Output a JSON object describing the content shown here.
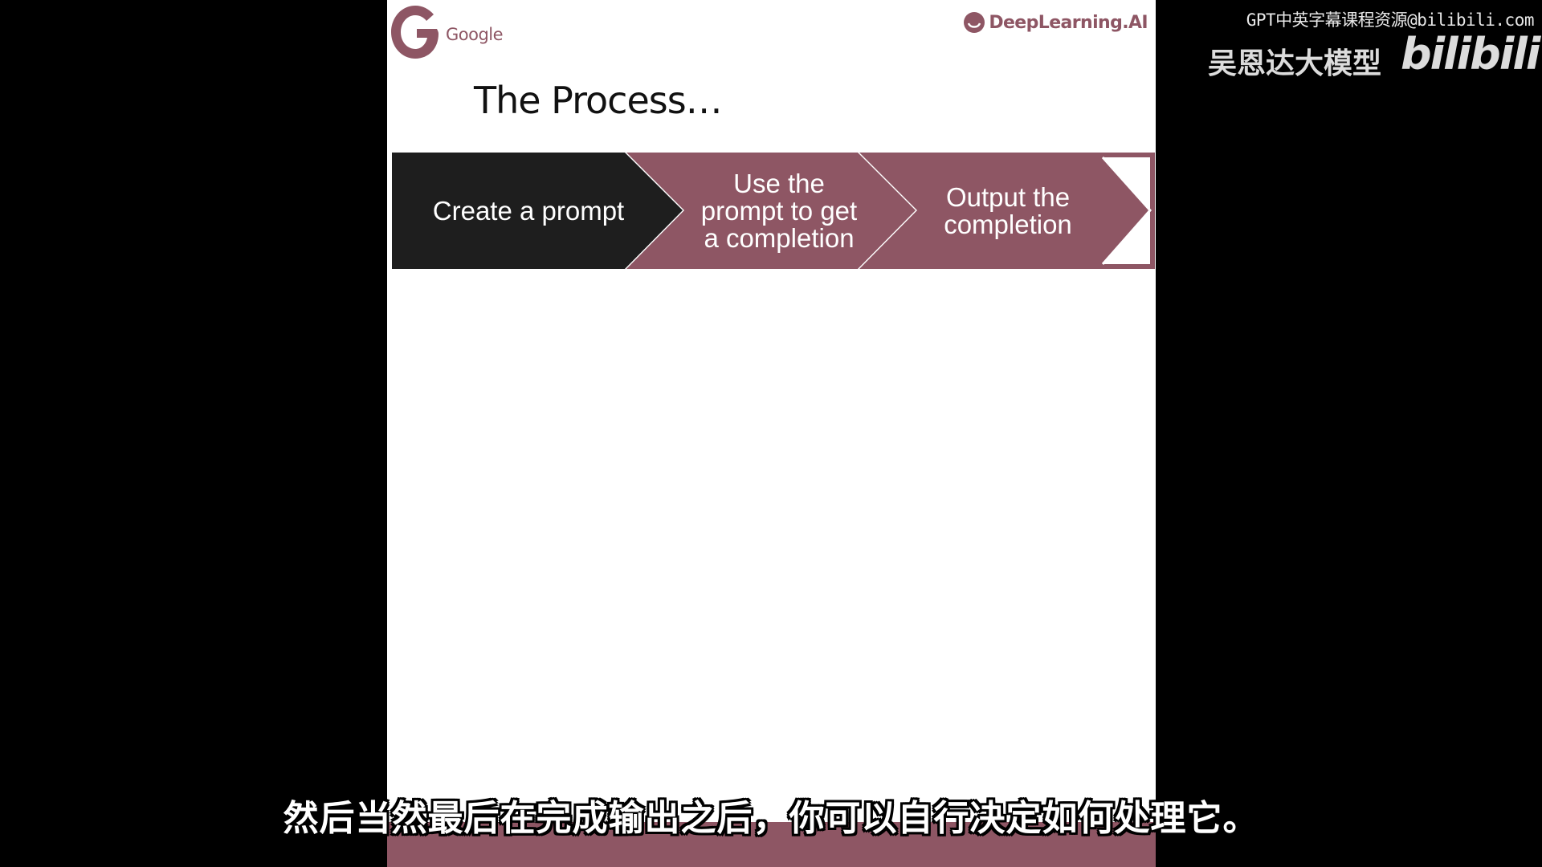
{
  "colors": {
    "brand_mauve": "#8E5664",
    "step_dark": "#1E1E1E",
    "slide_bg": "#FFFFFF",
    "outer_bg": "#000000"
  },
  "slide": {
    "logos": {
      "google": {
        "text": "Google",
        "icon": "google-g-icon"
      },
      "deeplearning": {
        "text": "DeepLearning.AI",
        "icon": "deeplearning-smile-icon"
      }
    },
    "title": "The Process…",
    "process_steps": [
      {
        "label": "Create a prompt",
        "style": "dark"
      },
      {
        "label": "Use the\nprompt to get\na completion",
        "style": "mauve"
      },
      {
        "label": "Output the\ncompletion",
        "style": "mauve"
      }
    ]
  },
  "overlay": {
    "watermark_top": "GPT中英字幕课程资源@bilibili.com",
    "watermark_channel": "吴恩达大模型",
    "bilibili_logo": "bilibili",
    "subtitle": "然后当然最后在完成输出之后，你可以自行决定如何处理它。"
  }
}
